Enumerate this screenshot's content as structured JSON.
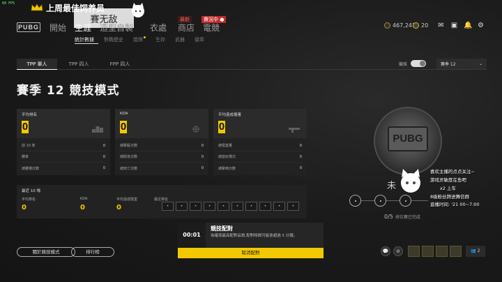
{
  "overlay": {
    "fps": "60 FPS",
    "banner": "上周最佳饲养员",
    "anime_caption": "賽无敌"
  },
  "nav": {
    "logo": "PUBG",
    "items": [
      "開始",
      "生涯",
      "造型自製",
      "衣處",
      "商店",
      "電競"
    ],
    "active": "生涯",
    "badge_new": "最新",
    "badge_live": "賽況中 ●",
    "sub_items": [
      "統計數據",
      "對戰歷史",
      "獎牌",
      "生存",
      "武器",
      "徽章"
    ]
  },
  "currency": {
    "bp": "467,241",
    "g": "20"
  },
  "mode_tabs": [
    "TPP 單人",
    "TPP 四人",
    "FPP 四人"
  ],
  "ranked_label": "競技",
  "season_select": "賽季 12",
  "page_title": "賽季 12 競技模式",
  "cards": [
    {
      "label": "平均排名",
      "value": "0",
      "rows": [
        {
          "k": "前 10 率",
          "v": "0"
        },
        {
          "k": "勝率",
          "v": "0"
        },
        {
          "k": "總勝場次數",
          "v": "0"
        }
      ]
    },
    {
      "label": "KDA",
      "value": "0",
      "rows": [
        {
          "k": "總擊殺次數",
          "v": "0"
        },
        {
          "k": "總助攻次數",
          "v": "0"
        },
        {
          "k": "總死亡次數",
          "v": "0"
        }
      ]
    },
    {
      "label": "平均造成傷害",
      "value": "0",
      "rows": [
        {
          "k": "總傷害量",
          "v": "0"
        },
        {
          "k": "總遊玩場次",
          "v": "0"
        },
        {
          "k": "總擊倒次數",
          "v": "0"
        }
      ]
    }
  ],
  "recent": {
    "title": "最近 10 場",
    "cols": [
      "平均排名",
      "KDA",
      "平均造成傷害",
      "最近排名"
    ],
    "values": [
      "0",
      "0",
      "0"
    ],
    "rank_boxes": [
      "•",
      "•",
      "•",
      "•",
      "•",
      "•",
      "•",
      "•",
      "•",
      "•"
    ]
  },
  "buttons": {
    "about": "關於競技模式",
    "leaderboard": "排行榜"
  },
  "matchmaking": {
    "time": "00:01",
    "title": "競技配對",
    "desc": "為確保最高配對品質,配對時間可能會超過 5 分鐘。",
    "cancel": "取消配對"
  },
  "rank": {
    "emblem_text": "PUBG",
    "unranked": "未",
    "placement": "0/5",
    "placement_label": "排位賽已完成"
  },
  "live_overlay": {
    "lines": [
      "喜欢主播的点点关注~",
      "游戏灵敏度在鱼吧",
      "x2 上车",
      "8级粉丝牌进舞信群",
      "直播时间: '21 00~7:00"
    ]
  },
  "friends_count": "2"
}
